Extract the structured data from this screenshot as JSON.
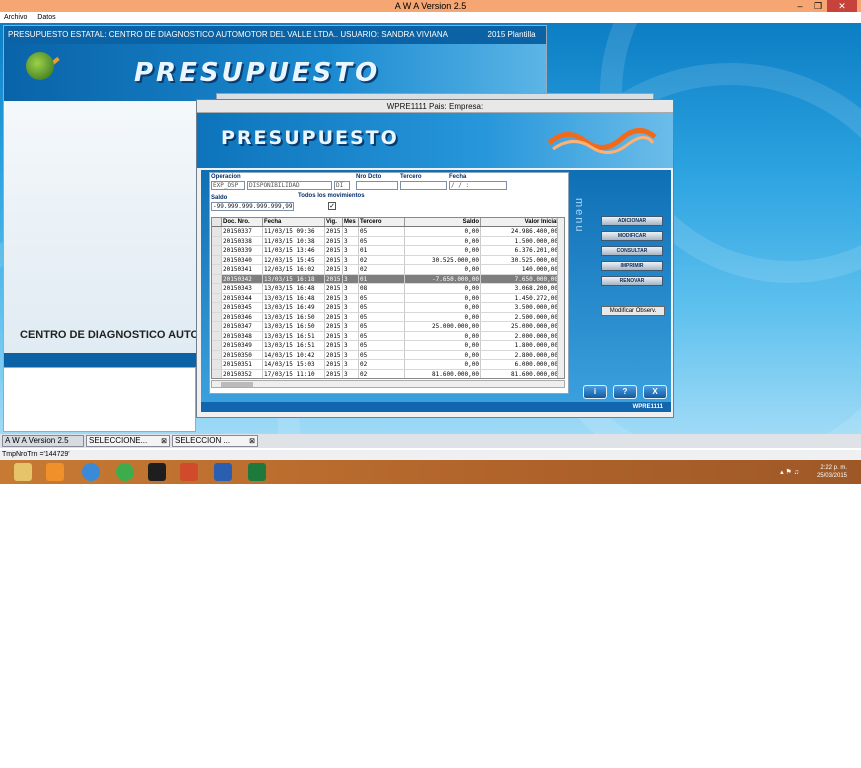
{
  "app": {
    "title": "A W A Version 2.5",
    "menu": [
      "Archivo",
      "Datos"
    ]
  },
  "back_window": {
    "title": "PRESUPUESTO ESTATAL: CENTRO DE DIAGNOSTICO AUTOMOTOR DEL VALLE LTDA.. USUARIO: SANDRA VIVIANA ESCOBAR VIG.:",
    "title_right": "2015  Plantilla  ...",
    "banner": "PRESUPUESTO",
    "company_label": "CENTRO DE DIAGNOSTICO AUTO"
  },
  "front_window": {
    "title": "WPRE1111 Pais:  Empresa:",
    "banner": "PRESUPUESTO",
    "form": {
      "operacion_label": "Operacion",
      "operacion_code": "EXP_DSP",
      "operacion_desc": "DISPONIBILIDAD",
      "operacion_extra": "DI",
      "nro_dcto_label": "Nro Dcto",
      "tercero_label": "Tercero",
      "fecha_label": "Fecha",
      "fecha_value": "/ /     :",
      "saldo_label": "Saldo",
      "saldo_value": "-99.999.999.999.999,99",
      "todos_label": "Todos los movimientos",
      "todos_checked": "✓"
    },
    "grid": {
      "headers": [
        "Doc. Nro.",
        "Fecha",
        "Vig.",
        "Mes",
        "Tercero",
        "Saldo",
        "Valor Inicial"
      ],
      "rows": [
        [
          "20150337",
          "11/03/15 09:36",
          "2015",
          "3",
          "05",
          "0,00",
          "24.986.400,00"
        ],
        [
          "20150338",
          "11/03/15 10:38",
          "2015",
          "3",
          "05",
          "0,00",
          "1.500.000,00"
        ],
        [
          "20150339",
          "11/03/15 13:46",
          "2015",
          "3",
          "01",
          "0,00",
          "6.376.201,00"
        ],
        [
          "20150340",
          "12/03/15 15:45",
          "2015",
          "3",
          "02",
          "30.525.000,00",
          "30.525.000,00"
        ],
        [
          "20150341",
          "12/03/15 16:02",
          "2015",
          "3",
          "02",
          "0,00",
          "140.000,00"
        ],
        [
          "20150342",
          "13/03/15 16:18",
          "2015",
          "3",
          "01",
          "-7.650.000,00",
          "7.650.000,00"
        ],
        [
          "20150343",
          "13/03/15 16:48",
          "2015",
          "3",
          "08",
          "0,00",
          "3.068.200,00"
        ],
        [
          "20150344",
          "13/03/15 16:48",
          "2015",
          "3",
          "05",
          "0,00",
          "1.450.272,00"
        ],
        [
          "20150345",
          "13/03/15 16:49",
          "2015",
          "3",
          "05",
          "0,00",
          "3.500.000,00"
        ],
        [
          "20150346",
          "13/03/15 16:50",
          "2015",
          "3",
          "05",
          "0,00",
          "2.500.000,00"
        ],
        [
          "20150347",
          "13/03/15 16:50",
          "2015",
          "3",
          "05",
          "25.000.000,00",
          "25.000.000,00"
        ],
        [
          "20150348",
          "13/03/15 16:51",
          "2015",
          "3",
          "05",
          "0,00",
          "2.000.000,00"
        ],
        [
          "20150349",
          "13/03/15 16:51",
          "2015",
          "3",
          "05",
          "0,00",
          "1.800.000,00"
        ],
        [
          "20150350",
          "14/03/15 10:42",
          "2015",
          "3",
          "05",
          "0,00",
          "2.800.000,00"
        ],
        [
          "20150351",
          "14/03/15 15:03",
          "2015",
          "3",
          "02",
          "0,00",
          "6.000.000,00"
        ],
        [
          "20150352",
          "17/03/15 11:10",
          "2015",
          "3",
          "02",
          "81.600.000,00",
          "81.600.000,00"
        ]
      ],
      "selected_row_index": 5
    },
    "menu_vertical": "menu",
    "buttons": {
      "adicionar": "ADICIONAR",
      "modificar": "MODIFICAR",
      "consultar": "CONSULTAR",
      "imprimir": "IMPRIMIR",
      "renovar": "RENOVAR",
      "modificar_observ": "Modificar Observ."
    },
    "nav": [
      "i",
      "?",
      "X"
    ],
    "status_code": "WPRE1111"
  },
  "tasks": {
    "awa": "A W A Version 2.5",
    "sel1": "SELECCIONE...",
    "sel2": "SELECCION ...",
    "close": "⊠"
  },
  "statusline": "TmpNroTrn ='144729'",
  "os": {
    "time": "2:22 p. m.",
    "date": "25/03/2015"
  }
}
